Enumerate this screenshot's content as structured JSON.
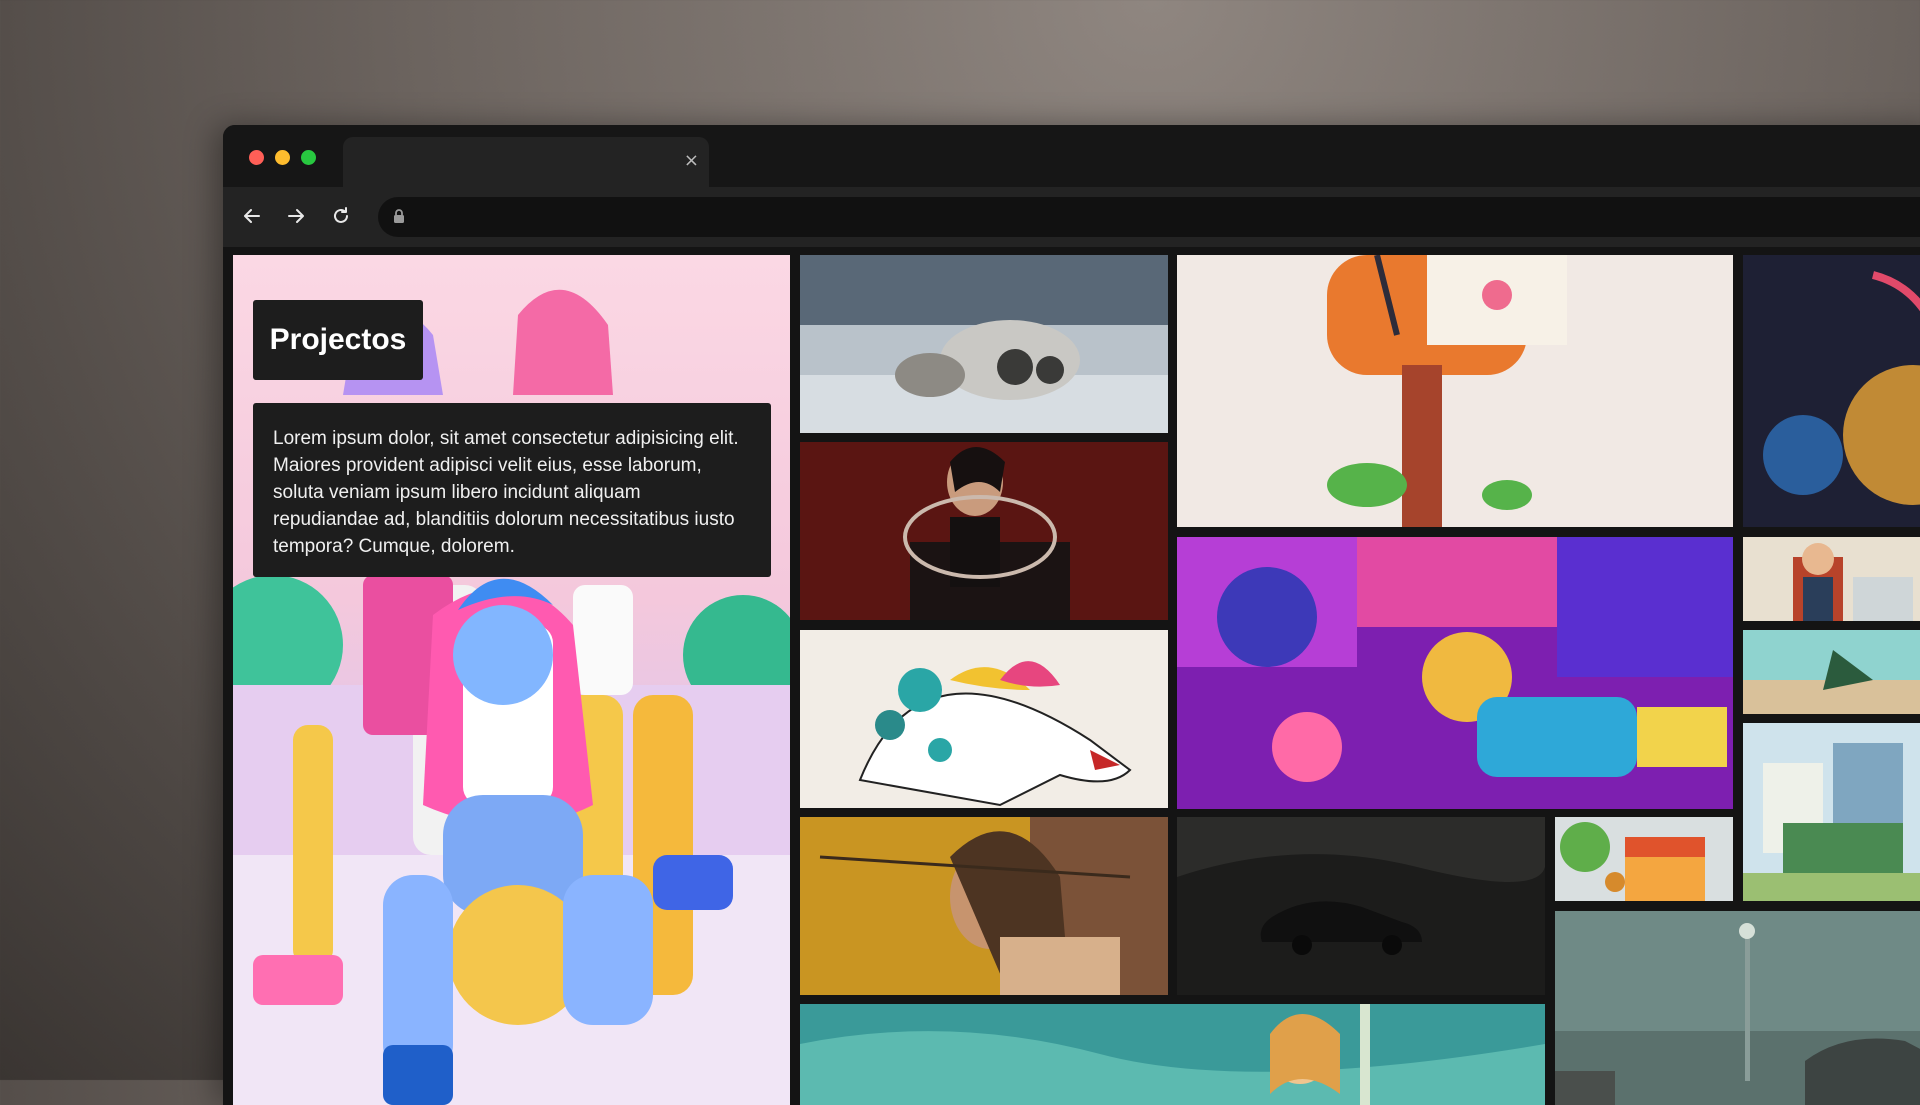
{
  "browser": {
    "tab": {
      "title": "",
      "close_glyph": "×"
    },
    "nav": {
      "back_icon": "arrow-left-icon",
      "forward_icon": "arrow-right-icon",
      "reload_icon": "reload-icon",
      "lock_icon": "lock-icon"
    },
    "url": ""
  },
  "page": {
    "title": "Projectos",
    "description": "Lorem ipsum dolor, sit amet consectetur adipisicing elit. Maiores provident adipisci velit eius, esse laborum, soluta veniam ipsum libero incidunt aliquam repudiandae ad, blanditiis dolorum necessitatibus iusto tempora? Cumque, dolorem."
  },
  "colors": {
    "traffic_red": "#ff5f57",
    "traffic_yellow": "#febc2e",
    "traffic_green": "#28c840",
    "panel_bg": "#1d1d1d",
    "page_bg": "#141414"
  }
}
